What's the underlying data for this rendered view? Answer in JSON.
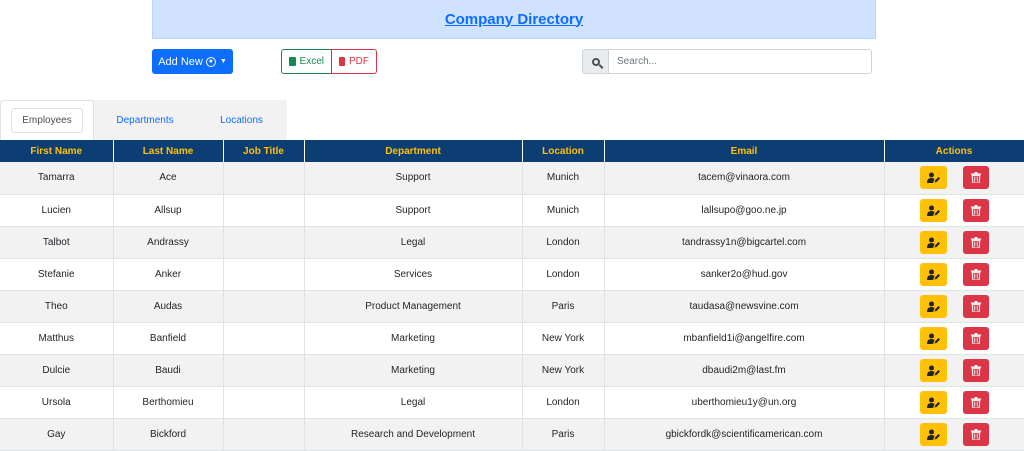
{
  "header": {
    "title": "Company Directory"
  },
  "toolbar": {
    "add_new_label": "Add New",
    "excel_label": "Excel",
    "pdf_label": "PDF",
    "search_placeholder": "Search..."
  },
  "tabs": [
    {
      "label": "Employees",
      "active": true
    },
    {
      "label": "Departments",
      "active": false
    },
    {
      "label": "Locations",
      "active": false
    }
  ],
  "table": {
    "columns": [
      "First Name",
      "Last Name",
      "Job Title",
      "Department",
      "Location",
      "Email",
      "Actions"
    ],
    "rows": [
      {
        "first": "Tamarra",
        "last": "Ace",
        "job": "",
        "dept": "Support",
        "loc": "Munich",
        "email": "tacem@vinaora.com"
      },
      {
        "first": "Lucien",
        "last": "Allsup",
        "job": "",
        "dept": "Support",
        "loc": "Munich",
        "email": "lallsupo@goo.ne.jp"
      },
      {
        "first": "Talbot",
        "last": "Andrassy",
        "job": "",
        "dept": "Legal",
        "loc": "London",
        "email": "tandrassy1n@bigcartel.com"
      },
      {
        "first": "Stefanie",
        "last": "Anker",
        "job": "",
        "dept": "Services",
        "loc": "London",
        "email": "sanker2o@hud.gov"
      },
      {
        "first": "Theo",
        "last": "Audas",
        "job": "",
        "dept": "Product Management",
        "loc": "Paris",
        "email": "taudasa@newsvine.com"
      },
      {
        "first": "Matthus",
        "last": "Banfield",
        "job": "",
        "dept": "Marketing",
        "loc": "New York",
        "email": "mbanfield1i@angelfire.com"
      },
      {
        "first": "Dulcie",
        "last": "Baudi",
        "job": "",
        "dept": "Marketing",
        "loc": "New York",
        "email": "dbaudi2m@last.fm"
      },
      {
        "first": "Ursola",
        "last": "Berthomieu",
        "job": "",
        "dept": "Legal",
        "loc": "London",
        "email": "uberthomieu1y@un.org"
      },
      {
        "first": "Gay",
        "last": "Bickford",
        "job": "",
        "dept": "Research and Development",
        "loc": "Paris",
        "email": "gbickfordk@scientificamerican.com"
      }
    ]
  },
  "colors": {
    "header_bg": "#0c3d73",
    "header_text": "#ffc107",
    "primary": "#0d6efd",
    "edit": "#ffc107",
    "delete": "#dc3545",
    "excel": "#198754"
  },
  "icons": {
    "add": "user-circle-icon",
    "excel": "file-excel-icon",
    "pdf": "file-pdf-icon",
    "search": "search-icon",
    "edit": "user-edit-icon",
    "delete": "trash-icon"
  }
}
